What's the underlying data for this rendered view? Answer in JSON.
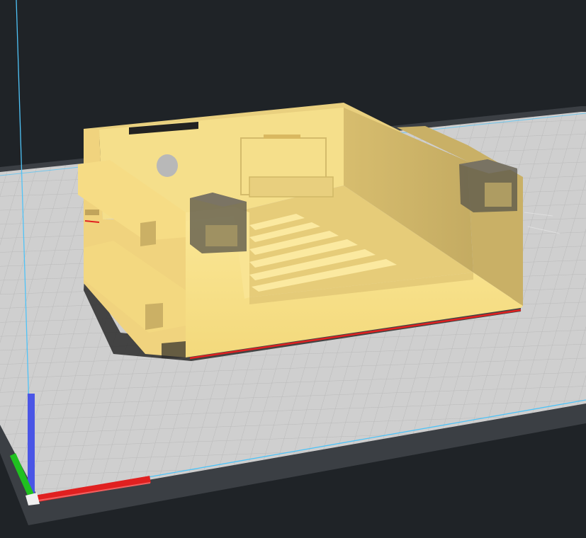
{
  "app": {
    "view": "3d-build-plate-viewport"
  },
  "colors": {
    "background": "#1f2327",
    "plate_border": "#3b3f44",
    "plate_surface": "#c9c9c9",
    "grid_line": "#b4b4b4",
    "build_volume_edge": "#4fc3f7",
    "model_yellow": "#f6e08a",
    "model_yellow_shade": "#d9c172",
    "model_yellow_dark": "#b9a35e",
    "model_shadow": "#2b2b2b",
    "support_grey": "#6f6a5a",
    "axis_x": "#e02020",
    "axis_y": "#20c020",
    "axis_z": "#4a55e6"
  },
  "objects": [
    {
      "name": "enclosure-box",
      "kind": "model",
      "color": "model_yellow"
    },
    {
      "name": "clip-left-front",
      "kind": "support-block",
      "color": "support_grey"
    },
    {
      "name": "clip-right-back",
      "kind": "support-block",
      "color": "support_grey"
    }
  ],
  "axes": [
    "x-axis",
    "y-axis",
    "z-axis"
  ]
}
